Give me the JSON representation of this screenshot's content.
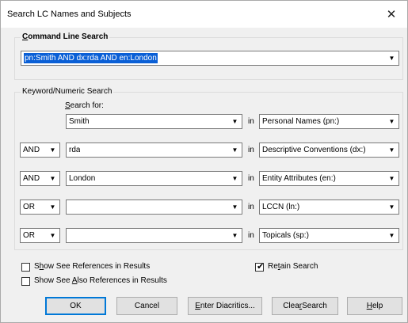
{
  "window": {
    "title": "Search LC Names and Subjects",
    "close_glyph": "✕"
  },
  "command_line": {
    "label_prefix": "C",
    "label_rest": "ommand Line Search",
    "value": "pn:Smith AND dx:rda AND en:London"
  },
  "keyword": {
    "group_label": "Keyword/Numeric Search",
    "search_for_prefix": "S",
    "search_for_rest": "earch for:",
    "in_label": "in",
    "rows": [
      {
        "op": "",
        "term": "Smith",
        "index": "Personal Names (pn:)"
      },
      {
        "op": "AND",
        "term": "rda",
        "index": "Descriptive Conventions (dx:)"
      },
      {
        "op": "AND",
        "term": "London",
        "index": "Entity Attributes (en:)"
      },
      {
        "op": "OR",
        "term": "",
        "index": "LCCN (ln:)"
      },
      {
        "op": "OR",
        "term": "",
        "index": "Topicals (sp:)"
      }
    ]
  },
  "options": {
    "show_see_refs": {
      "pre": "S",
      "ul": "h",
      "post": "ow See References in Results",
      "checked": false
    },
    "show_see_also_refs": {
      "pre": "Show See ",
      "ul": "A",
      "post": "lso References in Results",
      "checked": false
    },
    "retain_search": {
      "pre": "Re",
      "ul": "t",
      "post": "ain Search",
      "checked": true
    }
  },
  "buttons": {
    "ok": {
      "pre": "OK",
      "ul": "",
      "post": ""
    },
    "cancel": {
      "pre": "Cancel",
      "ul": "",
      "post": ""
    },
    "enter_diacritics": {
      "pre": "",
      "ul": "E",
      "post": "nter Diacritics..."
    },
    "clear_search": {
      "pre": "Clea",
      "ul": "r",
      "post": " Search"
    },
    "help": {
      "pre": "",
      "ul": "H",
      "post": "elp"
    }
  },
  "icons": {
    "dropdown": "chevron-down-icon",
    "check": "checkmark-icon"
  },
  "colors": {
    "selection": "#0a5fd6",
    "dialog_bg": "#f0f0f0",
    "default_button_border": "#0078d7"
  }
}
